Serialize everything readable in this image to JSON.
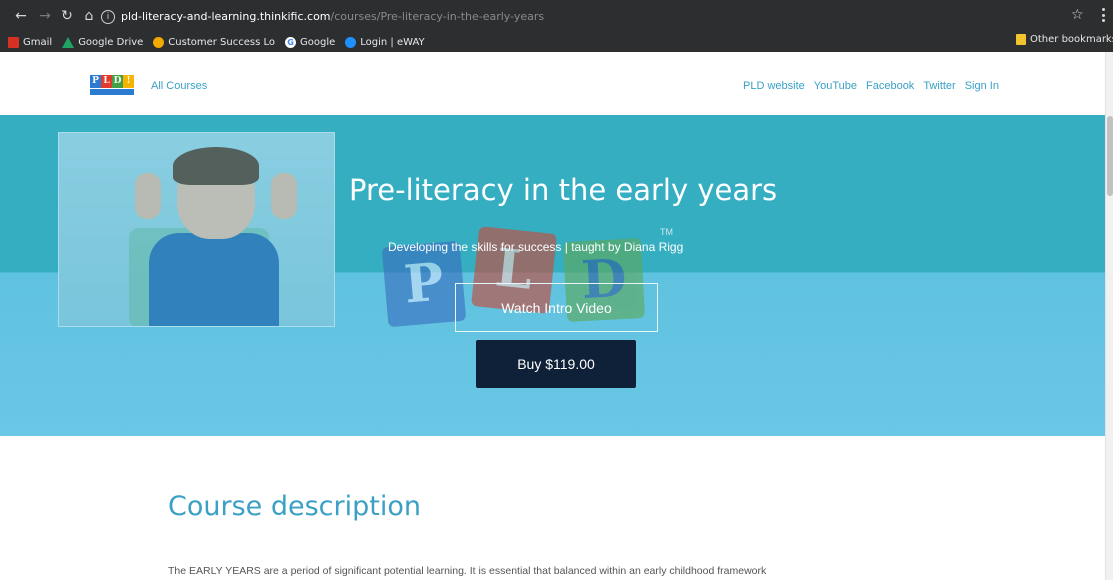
{
  "browser": {
    "url_host": "pld-literacy-and-learning.thinkific.com",
    "url_path": "/courses/Pre-literacy-in-the-early-years",
    "bookmarks": [
      {
        "label": "Gmail",
        "icon": "gmail-icon"
      },
      {
        "label": "Google Drive",
        "icon": "google-drive-icon"
      },
      {
        "label": "Customer Success Lo",
        "icon": "customer-success-icon"
      },
      {
        "label": "Google",
        "icon": "google-icon"
      },
      {
        "label": "Login | eWAY",
        "icon": "eway-icon"
      }
    ],
    "other_bookmarks": "Other bookmarks"
  },
  "header": {
    "logo_letters": [
      "P",
      "L",
      "D",
      "!"
    ],
    "all_courses": "All Courses",
    "nav": [
      "PLD website",
      "YouTube",
      "Facebook",
      "Twitter",
      "Sign In"
    ]
  },
  "hero": {
    "title": "Pre-literacy in the early years",
    "subtitle": "Developing the skills for success | taught by Diana Rigg",
    "blocks": [
      "P",
      "L",
      "D"
    ],
    "trademark": "TM",
    "intro_button": "Watch Intro Video",
    "buy_button": "Buy $119.00",
    "colors": {
      "top": "#35aec1",
      "bottom": "#6ac7e6",
      "buy_bg": "#0f2138"
    }
  },
  "content": {
    "section_title": "Course description",
    "paragraph": "The EARLY YEARS are a period of significant potential learning. It is essential that balanced within an early childhood framework"
  }
}
